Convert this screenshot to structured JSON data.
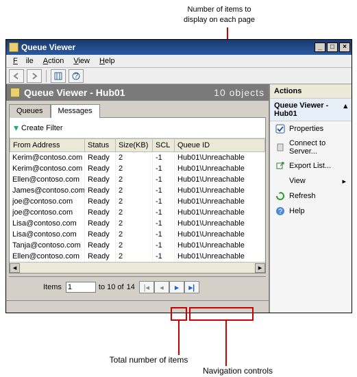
{
  "annotations": {
    "top": "Number of items to\ndisplay on each page",
    "bottom_left": "Total number of items",
    "bottom_right": "Navigation controls"
  },
  "window": {
    "title": "Queue Viewer",
    "menu": {
      "file": "File",
      "action": "Action",
      "view": "View",
      "help": "Help"
    }
  },
  "header": {
    "title": "Queue Viewer - Hub01",
    "object_count": "10 objects"
  },
  "tabs": {
    "queues": "Queues",
    "messages": "Messages"
  },
  "filter": {
    "create": "Create Filter"
  },
  "grid": {
    "cols": {
      "from": "From Address",
      "status": "Status",
      "size": "Size(KB)",
      "scl": "SCL",
      "qid": "Queue ID"
    },
    "rows": [
      {
        "from": "Kerim@contoso.com",
        "status": "Ready",
        "size": "2",
        "scl": "-1",
        "qid": "Hub01\\Unreachable"
      },
      {
        "from": "Kerim@contoso.com",
        "status": "Ready",
        "size": "2",
        "scl": "-1",
        "qid": "Hub01\\Unreachable"
      },
      {
        "from": "Ellen@contoso.com",
        "status": "Ready",
        "size": "2",
        "scl": "-1",
        "qid": "Hub01\\Unreachable"
      },
      {
        "from": "James@contoso.com",
        "status": "Ready",
        "size": "2",
        "scl": "-1",
        "qid": "Hub01\\Unreachable"
      },
      {
        "from": "joe@contoso.com",
        "status": "Ready",
        "size": "2",
        "scl": "-1",
        "qid": "Hub01\\Unreachable"
      },
      {
        "from": "joe@contoso.com",
        "status": "Ready",
        "size": "2",
        "scl": "-1",
        "qid": "Hub01\\Unreachable"
      },
      {
        "from": "Lisa@contoso.com",
        "status": "Ready",
        "size": "2",
        "scl": "-1",
        "qid": "Hub01\\Unreachable"
      },
      {
        "from": "Lisa@contoso.com",
        "status": "Ready",
        "size": "2",
        "scl": "-1",
        "qid": "Hub01\\Unreachable"
      },
      {
        "from": "Tanja@contoso.com",
        "status": "Ready",
        "size": "2",
        "scl": "-1",
        "qid": "Hub01\\Unreachable"
      },
      {
        "from": "Ellen@contoso.com",
        "status": "Ready",
        "size": "2",
        "scl": "-1",
        "qid": "Hub01\\Unreachable"
      }
    ]
  },
  "pager": {
    "items_label": "Items",
    "page_from": "1",
    "mid": "to 10 of",
    "total": "14"
  },
  "actions": {
    "header": "Actions",
    "sub": "Queue Viewer - Hub01",
    "items": {
      "properties": "Properties",
      "connect": "Connect to Server...",
      "export": "Export List...",
      "view": "View",
      "refresh": "Refresh",
      "help": "Help"
    }
  }
}
